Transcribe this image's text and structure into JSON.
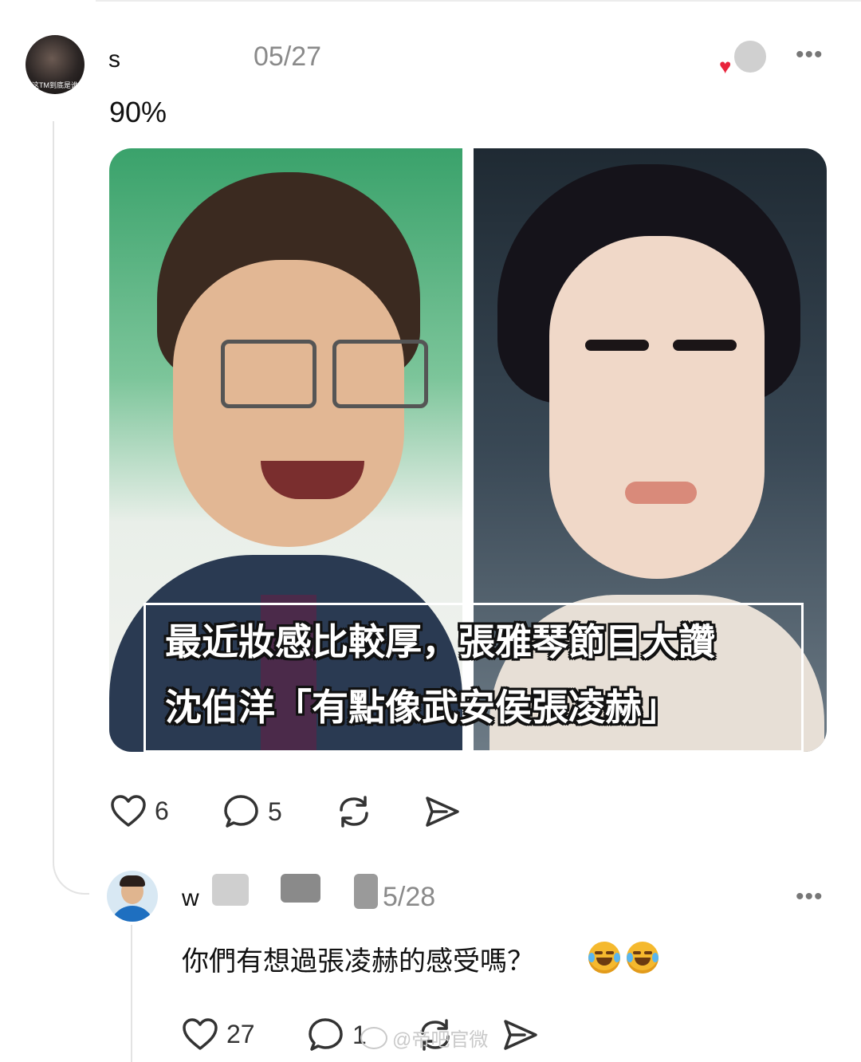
{
  "post": {
    "username": "s",
    "date": "05/27",
    "text": "90%",
    "avatar_caption": "这TM到底是谁",
    "media": {
      "caption_line1": "最近妝感比較厚，張雅琴節目大讚",
      "caption_line2": "沈伯洋「有點像武安侯張凌赫」"
    },
    "actions": {
      "likes": "6",
      "comments": "5"
    }
  },
  "reply": {
    "username": "w",
    "date": "5/28",
    "text": "你們有想過張凌赫的感受嗎？",
    "emoji": "rolling-on-floor-laughing-icon",
    "actions": {
      "likes": "27",
      "comments": "1"
    }
  },
  "watermark": {
    "text": "@帝吧官微"
  },
  "colors": {
    "heart": "#e8243c",
    "icon": "#333333",
    "muted": "#8a8a8a"
  }
}
